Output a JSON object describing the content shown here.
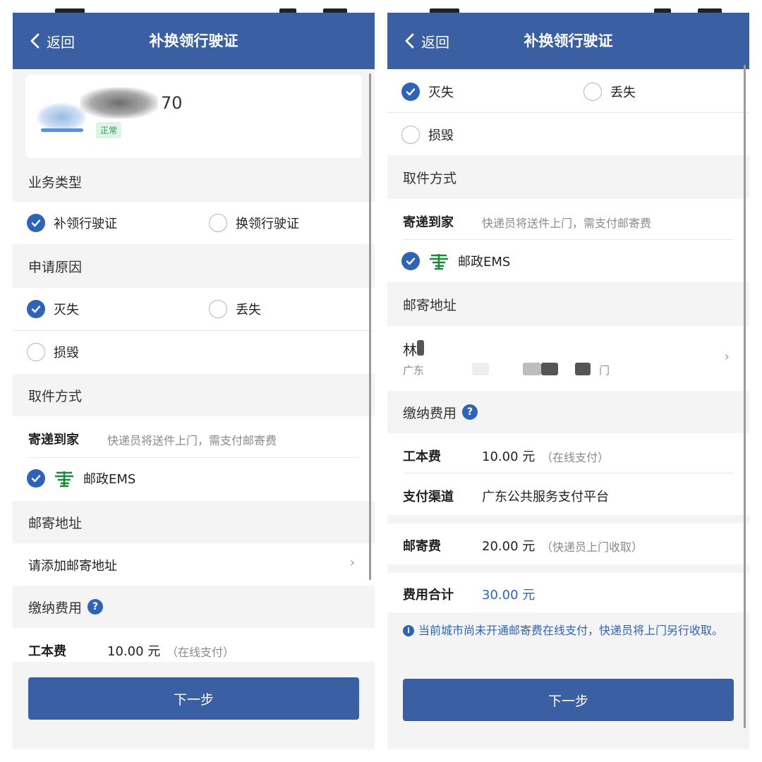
{
  "left": {
    "header": {
      "back": "返回",
      "title": "补换领行驶证"
    },
    "card": {
      "number_suffix": "70",
      "status": "正常"
    },
    "business_type": {
      "label": "业务类型",
      "options": [
        {
          "label": "补领行驶证",
          "checked": true
        },
        {
          "label": "换领行驶证",
          "checked": false
        }
      ]
    },
    "reason": {
      "label": "申请原因",
      "options": [
        {
          "label": "灭失",
          "checked": true
        },
        {
          "label": "丢失",
          "checked": false
        },
        {
          "label": "损毁",
          "checked": false
        }
      ]
    },
    "pickup": {
      "label": "取件方式",
      "method": "寄递到家",
      "hint": "快递员将送件上门，需支付邮寄费",
      "carrier": "邮政EMS"
    },
    "address": {
      "label": "邮寄地址",
      "placeholder": "请添加邮寄地址"
    },
    "fees": {
      "label": "缴纳费用",
      "items": [
        {
          "name": "工本费",
          "amount": "10.00 元",
          "note": "（在线支付）"
        }
      ]
    },
    "next": "下一步"
  },
  "right": {
    "header": {
      "back": "返回",
      "title": "补换领行驶证"
    },
    "reason": {
      "options": [
        {
          "label": "灭失",
          "checked": true
        },
        {
          "label": "丢失",
          "checked": false
        },
        {
          "label": "损毁",
          "checked": false
        }
      ]
    },
    "pickup": {
      "label": "取件方式",
      "method": "寄递到家",
      "hint": "快递员将送件上门，需支付邮寄费",
      "carrier": "邮政EMS"
    },
    "address": {
      "label": "邮寄地址",
      "name": "林",
      "line_start": "广东",
      "line_end": "门"
    },
    "fees": {
      "label": "缴纳费用",
      "items": [
        {
          "name": "工本费",
          "amount": "10.00 元",
          "note": "（在线支付）"
        },
        {
          "name": "支付渠道",
          "amount": "广东公共服务支付平台",
          "note": ""
        },
        {
          "name": "邮寄费",
          "amount": "20.00 元",
          "note": "（快递员上门收取）"
        },
        {
          "name": "费用合计",
          "amount": "30.00 元",
          "note": ""
        }
      ],
      "notice": "当前城市尚未开通邮寄费在线支付，快递员将上门另行收取。"
    },
    "next": "下一步"
  },
  "icons": {
    "back": "chevron-left-icon",
    "check": "check-circle-icon",
    "radio": "radio-empty-icon",
    "help": "question-icon",
    "info": "info-icon",
    "ems": "china-post-logo-icon",
    "chevron": "chevron-right-icon"
  },
  "colors": {
    "header": "#3a60a3",
    "accent": "#2f63b6",
    "total": "#2f63b6",
    "ems_green": "#1a8a3a",
    "status_green": "#2e9c5b"
  }
}
